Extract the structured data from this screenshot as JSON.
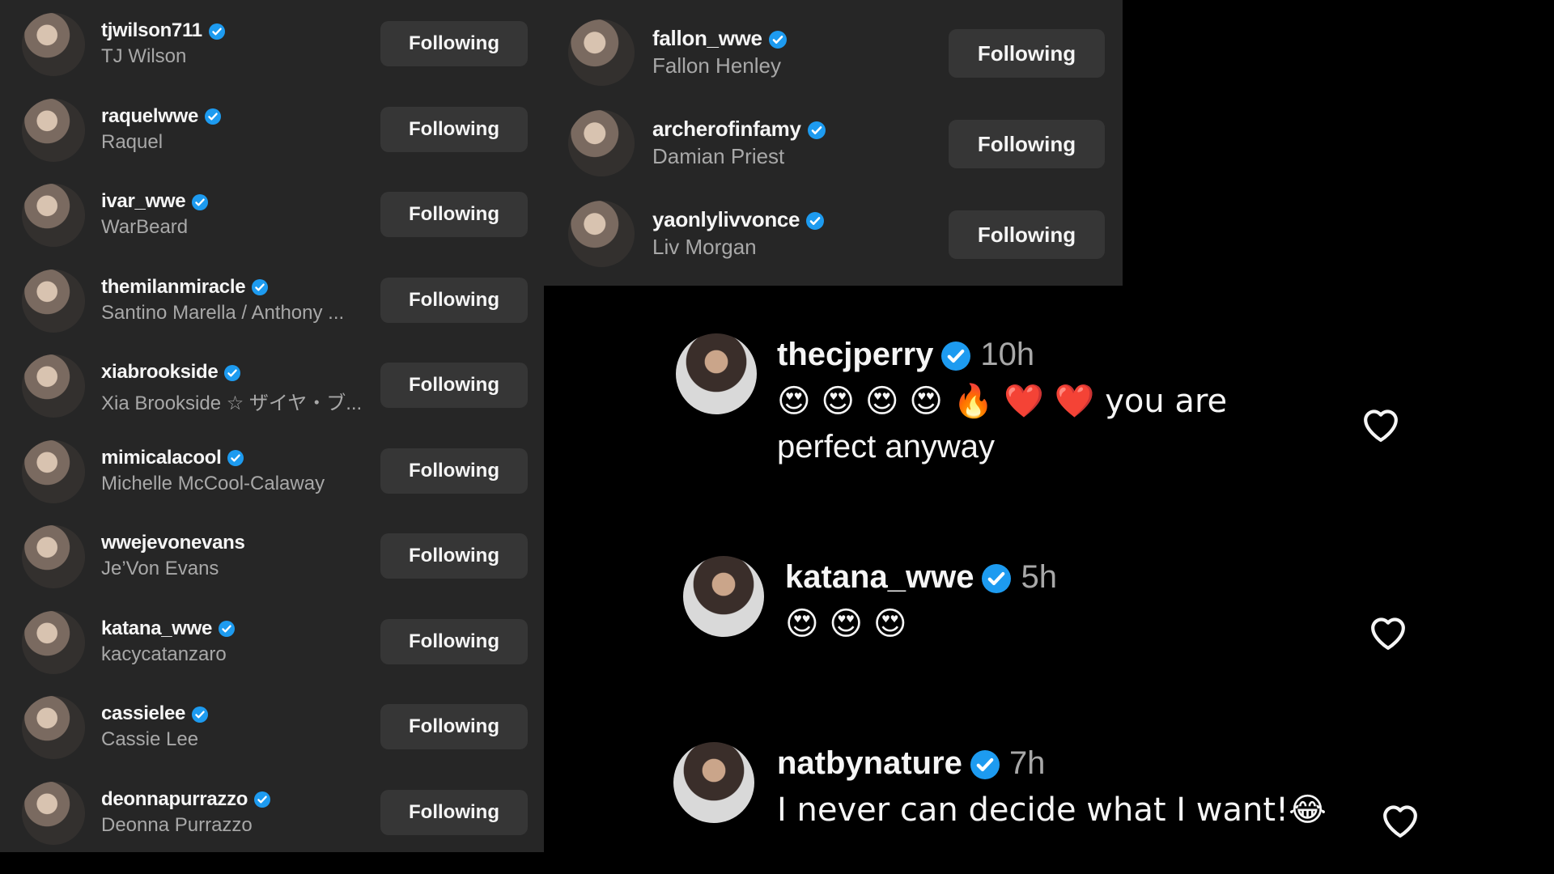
{
  "following_list_left": [
    {
      "username": "tjwilson711",
      "full_name": "TJ Wilson",
      "verified": true,
      "button": "Following"
    },
    {
      "username": "raquelwwe",
      "full_name": "Raquel",
      "verified": true,
      "button": "Following"
    },
    {
      "username": "ivar_wwe",
      "full_name": "WarBeard",
      "verified": true,
      "button": "Following"
    },
    {
      "username": "themilanmiracle",
      "full_name": "Santino Marella / Anthony ...",
      "verified": true,
      "button": "Following"
    },
    {
      "username": "xiabrookside",
      "full_name": "Xia Brookside ☆ ザイヤ・ブ...",
      "verified": true,
      "button": "Following"
    },
    {
      "username": "mimicalacool",
      "full_name": "Michelle McCool-Calaway",
      "verified": true,
      "button": "Following"
    },
    {
      "username": "wwejevonevans",
      "full_name": "Je’Von Evans",
      "verified": false,
      "button": "Following"
    },
    {
      "username": "katana_wwe",
      "full_name": "kacycatanzaro",
      "verified": true,
      "button": "Following"
    },
    {
      "username": "cassielee",
      "full_name": "Cassie Lee",
      "verified": true,
      "button": "Following"
    },
    {
      "username": "deonnapurrazzo",
      "full_name": "Deonna Purrazzo",
      "verified": true,
      "button": "Following"
    }
  ],
  "following_list_right": [
    {
      "username": "fallon_wwe",
      "full_name": "Fallon Henley",
      "verified": true,
      "button": "Following"
    },
    {
      "username": "archerofinfamy",
      "full_name": "Damian Priest",
      "verified": true,
      "button": "Following"
    },
    {
      "username": "yaonlylivvonce",
      "full_name": "Liv Morgan",
      "verified": true,
      "button": "Following"
    }
  ],
  "comments": [
    {
      "username": "thecjperry",
      "verified": true,
      "time": "10h",
      "text_line1": "😍 😍 😍 😍 🔥 ❤️ ❤️ you are",
      "text_line2": "perfect anyway"
    },
    {
      "username": "katana_wwe",
      "verified": true,
      "time": "5h",
      "text_line1": "😍 😍 😍",
      "text_line2": ""
    },
    {
      "username": "natbynature",
      "verified": true,
      "time": "7h",
      "text_line1": "I never can decide what I want!😂",
      "text_line2": ""
    }
  ],
  "colors": {
    "panel_bg": "#262626",
    "button_bg": "#363636",
    "verified_blue": "#1d9bf0",
    "secondary_text": "#a8a8a8"
  },
  "icons": {
    "verified": "verified-badge-icon",
    "like": "heart-outline-icon"
  }
}
